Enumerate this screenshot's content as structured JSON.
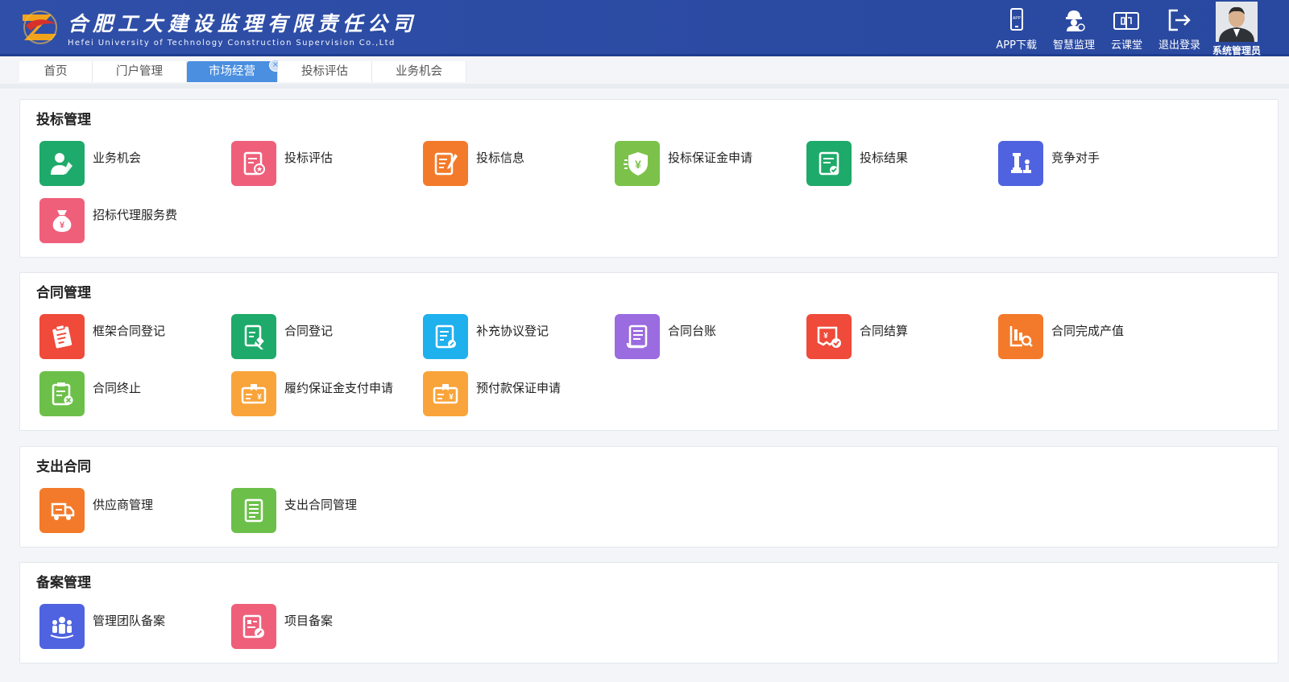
{
  "header": {
    "company_cn": "合肥工大建设监理有限责任公司",
    "company_en": "Hefei University of Technology Construction Supervision Co.,Ltd",
    "actions": [
      {
        "label": "APP下载",
        "icon": "phone-download-icon"
      },
      {
        "label": "智慧监理",
        "icon": "worker-helmet-icon"
      },
      {
        "label": "云课堂",
        "icon": "book-icon"
      },
      {
        "label": "退出登录",
        "icon": "logout-icon"
      }
    ],
    "user_name": "系统管理员"
  },
  "tabs": [
    {
      "label": "首页",
      "active": false
    },
    {
      "label": "门户管理",
      "active": false
    },
    {
      "label": "市场经营",
      "active": true
    },
    {
      "label": "投标评估",
      "active": false
    },
    {
      "label": "业务机会",
      "active": false
    }
  ],
  "sections": [
    {
      "title": "投标管理",
      "items": [
        {
          "label": "业务机会",
          "color": "#1eaa6a",
          "icon": "person-pen-icon"
        },
        {
          "label": "投标评估",
          "color": "#ef5f7a",
          "icon": "document-star-icon"
        },
        {
          "label": "投标信息",
          "color": "#f37a2a",
          "icon": "document-pen-icon"
        },
        {
          "label": "投标保证金申请",
          "color": "#7cc24a",
          "icon": "shield-yen-icon"
        },
        {
          "label": "投标结果",
          "color": "#1eaa6a",
          "icon": "document-check-icon"
        },
        {
          "label": "竞争对手",
          "color": "#4f63e0",
          "icon": "chess-icon"
        },
        {
          "label": "招标代理服务费",
          "color": "#ef5f7a",
          "icon": "money-bag-icon"
        }
      ]
    },
    {
      "title": "合同管理",
      "items": [
        {
          "label": "框架合同登记",
          "color": "#ef4a3a",
          "icon": "clipboard-icon"
        },
        {
          "label": "合同登记",
          "color": "#1eaa6a",
          "icon": "document-sign-icon"
        },
        {
          "label": "补充协议登记",
          "color": "#1fb0ee",
          "icon": "document-edit-icon"
        },
        {
          "label": "合同台账",
          "color": "#9b6be0",
          "icon": "scroll-icon"
        },
        {
          "label": "合同结算",
          "color": "#ef4a3a",
          "icon": "invoice-check-icon"
        },
        {
          "label": "合同完成产值",
          "color": "#f37a2a",
          "icon": "report-search-icon"
        },
        {
          "label": "合同终止",
          "color": "#6cc04a",
          "icon": "clipboard-cancel-icon"
        },
        {
          "label": "履约保证金支付申请",
          "color": "#f9a43a",
          "icon": "certificate-yen-icon"
        },
        {
          "label": "预付款保证申请",
          "color": "#f9a43a",
          "icon": "certificate-yen-icon"
        }
      ]
    },
    {
      "title": "支出合同",
      "items": [
        {
          "label": "供应商管理",
          "color": "#f37a2a",
          "icon": "truck-icon"
        },
        {
          "label": "支出合同管理",
          "color": "#6cc04a",
          "icon": "document-lines-icon"
        }
      ]
    },
    {
      "title": "备案管理",
      "items": [
        {
          "label": "管理团队备案",
          "color": "#4f63e0",
          "icon": "team-icon"
        },
        {
          "label": "项目备案",
          "color": "#ef5f7a",
          "icon": "document-pencil-icon"
        }
      ]
    }
  ]
}
